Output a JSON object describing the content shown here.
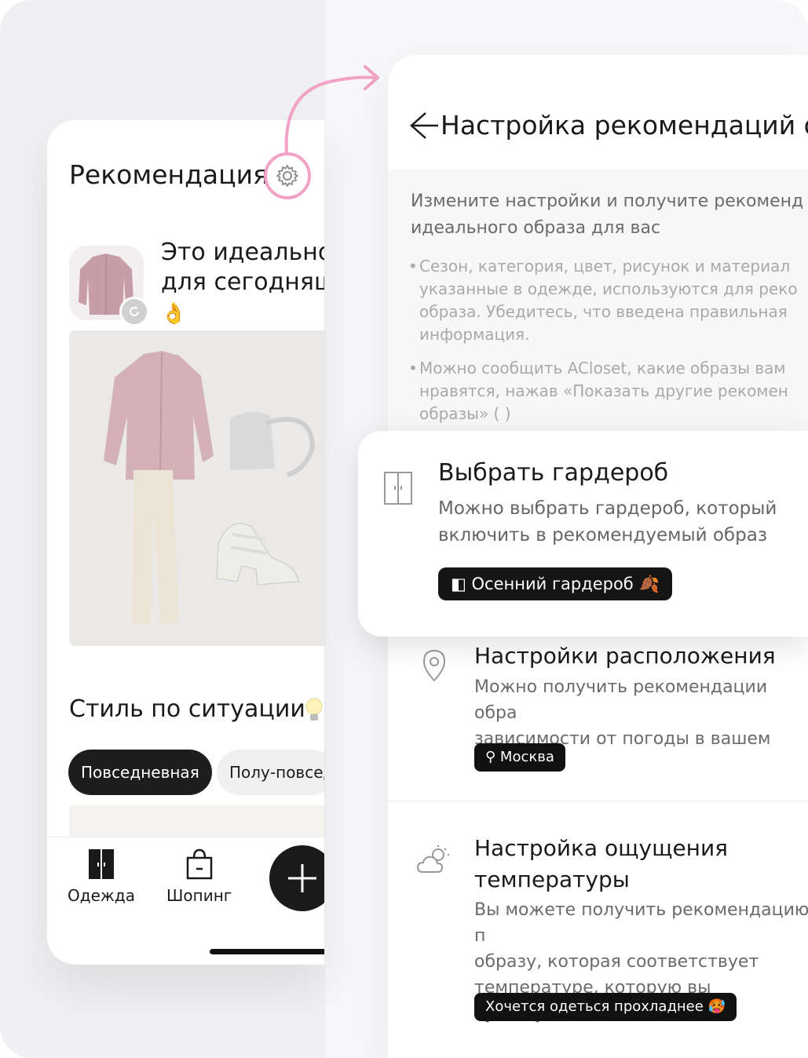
{
  "left_screen": {
    "title": "Рекомендация",
    "headline": "Это идеально\nдля сегодняш",
    "headline_emoji": "👌",
    "style_section_title": "Стиль по ситуации",
    "chips": [
      "Повседневная",
      "Полу-повсед"
    ],
    "nav": {
      "clothes_label": "Одежда",
      "shopping_label": "Шопинг"
    }
  },
  "right_screen": {
    "title": "Настройка рекомендаций об",
    "intro": "Измените настройки и получите рекоменд\nидеального образа для вас",
    "bullets": [
      "Сезон, категория, цвет, рисунок и материал\nуказанные в одежде, используются для реко\nобраза. Убедитесь, что введена правильная\nинформация.",
      "Можно сообщить ACloset, какие образы вам\nнравятся, нажав «Показать другие рекомен\nобразы» (    )"
    ],
    "wardrobe": {
      "title": "Выбрать гардероб",
      "description": "Можно выбрать гардероб, который\nвключить в рекомендуемый образ",
      "selected": "Осенний гардероб"
    },
    "location": {
      "title": "Настройки расположения",
      "description": "Можно получить рекомендации обра\nзависимости от погоды в вашем мест",
      "selected": "Москва"
    },
    "temperature": {
      "title": "Настройка ощущения\nтемпературы",
      "description": "Вы можете получить рекомендацию п\nобразу, которая соответствует\nтемпературе, которую вы чувствуете.",
      "selected": "Хочется одеться прохладнее"
    }
  },
  "colors": {
    "accent_pink": "#f2a2c4",
    "dark": "#111111"
  }
}
